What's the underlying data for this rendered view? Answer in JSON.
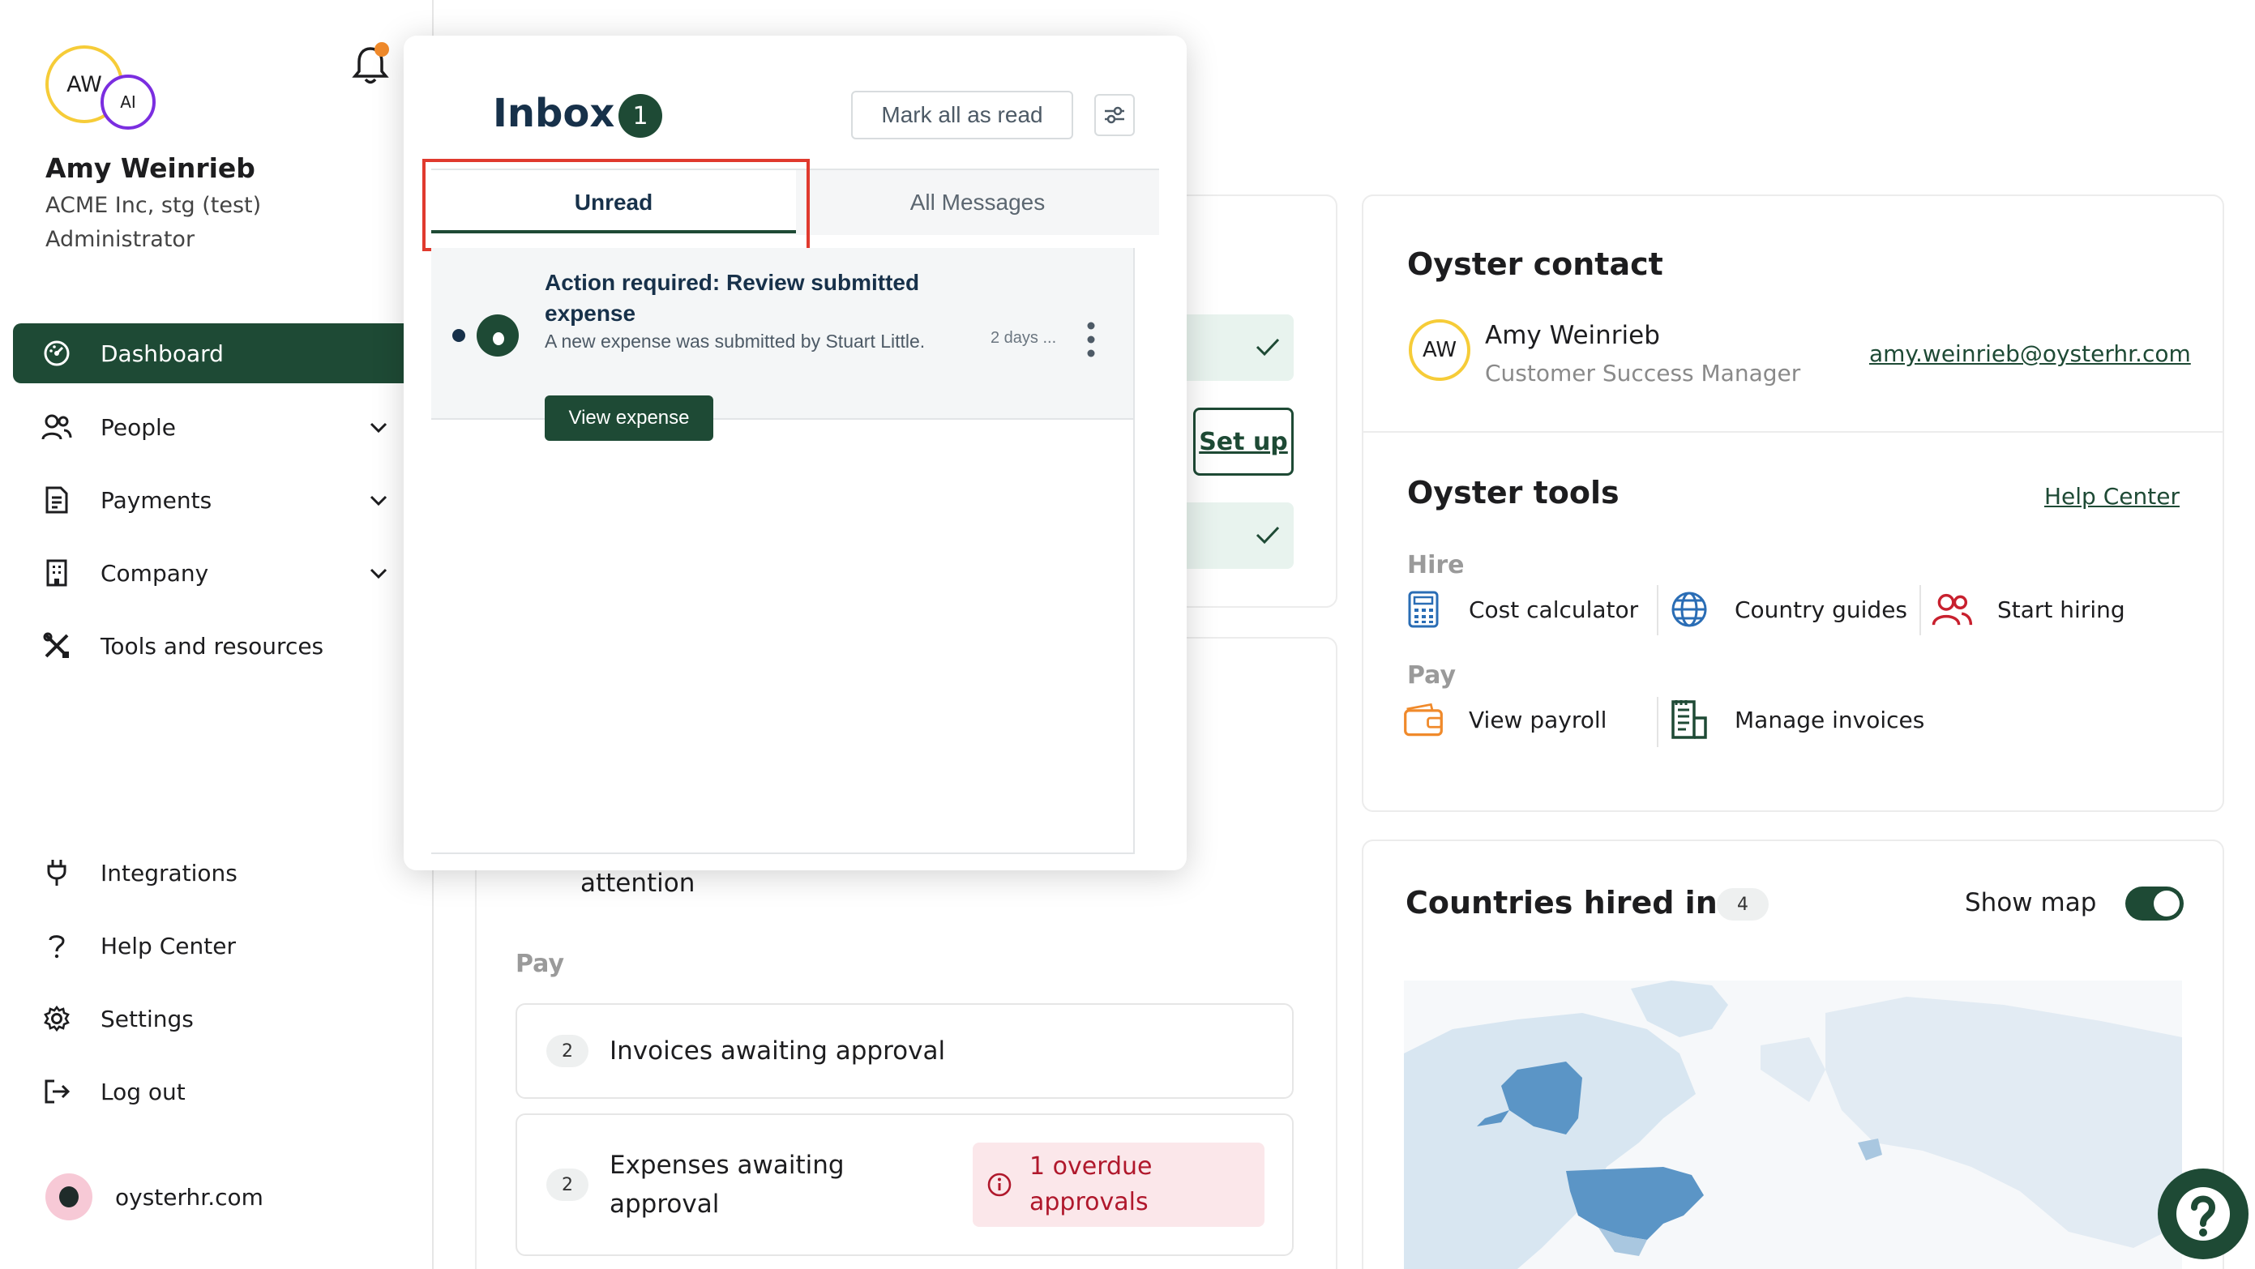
{
  "user": {
    "initials": "AW",
    "secondary_initials": "AI",
    "name": "Amy Weinrieb",
    "company": "ACME Inc, stg (test)",
    "role": "Administrator"
  },
  "nav": {
    "dashboard": "Dashboard",
    "people": "People",
    "payments": "Payments",
    "company": "Company",
    "tools": "Tools and resources",
    "integrations": "Integrations",
    "help_center": "Help Center",
    "settings": "Settings",
    "logout": "Log out",
    "site": "oysterhr.com"
  },
  "main": {
    "setup_label": "Set up",
    "attention_text": "attention",
    "pay_heading": "Pay",
    "invoices": {
      "count": "2",
      "label": "Invoices awaiting approval"
    },
    "expenses": {
      "count": "2",
      "label_line1": "Expenses awaiting",
      "label_line2": "approval",
      "overdue_line1": "1 overdue",
      "overdue_line2": "approvals"
    }
  },
  "contact": {
    "title": "Oyster contact",
    "initials": "AW",
    "name": "Amy Weinrieb",
    "role": "Customer Success Manager",
    "email": "amy.weinrieb@oysterhr.com"
  },
  "tools": {
    "title": "Oyster tools",
    "help_link": "Help Center",
    "hire_heading": "Hire",
    "cost_calculator": "Cost calculator",
    "country_guides": "Country guides",
    "start_hiring": "Start hiring",
    "pay_heading": "Pay",
    "view_payroll": "View payroll",
    "manage_invoices": "Manage invoices"
  },
  "countries": {
    "title": "Countries hired in",
    "count": "4",
    "show_map_label": "Show map",
    "show_map_on": true
  },
  "inbox": {
    "title": "Inbox",
    "badge": "1",
    "mark_all": "Mark all as read",
    "tabs": {
      "unread": "Unread",
      "all": "All Messages"
    },
    "messages": [
      {
        "title": "Action required: Review submitted expense",
        "body": "A new expense was submitted by Stuart Little.",
        "time": "2 days ...",
        "action": "View expense"
      }
    ]
  },
  "colors": {
    "brand_green": "#1e4a35",
    "highlight_red": "#e03a2e",
    "avatar_yellow": "#f6cc38",
    "avatar_purple": "#7b2ee0",
    "overdue_red": "#b0182c"
  }
}
